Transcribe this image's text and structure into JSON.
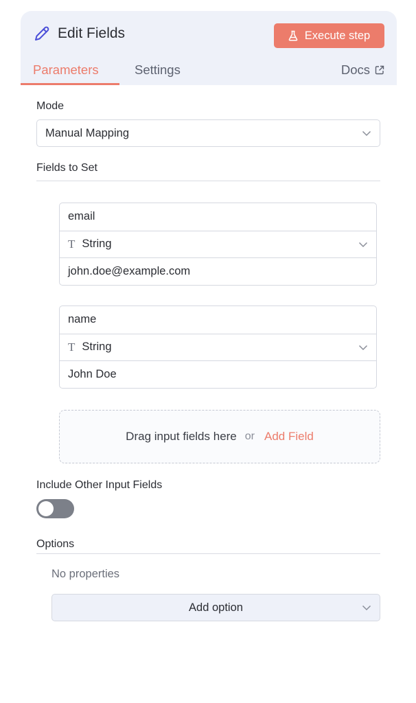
{
  "header": {
    "title": "Edit Fields",
    "execute_label": "Execute step",
    "tabs": [
      {
        "label": "Parameters",
        "active": true
      },
      {
        "label": "Settings",
        "active": false
      }
    ],
    "docs_label": "Docs"
  },
  "mode": {
    "label": "Mode",
    "value": "Manual Mapping"
  },
  "fields_section": {
    "label": "Fields to Set",
    "fields": [
      {
        "name": "email",
        "type": "String",
        "value": "john.doe@example.com"
      },
      {
        "name": "name",
        "type": "String",
        "value": "John Doe"
      }
    ],
    "dropzone": {
      "text": "Drag input fields here",
      "or": "or",
      "add_label": "Add Field"
    }
  },
  "include_other": {
    "label": "Include Other Input Fields",
    "enabled": false
  },
  "options": {
    "label": "Options",
    "empty_text": "No properties",
    "add_label": "Add option"
  },
  "icons": {
    "title_icon": "pencil-icon",
    "execute_icon": "flask-icon",
    "docs_icon": "external-link-icon",
    "type_icon": "text-type-icon",
    "dropdown_icon": "chevron-down-icon"
  },
  "colors": {
    "accent": "#ec7c6b",
    "header_bg": "#eef1f9",
    "pencil": "#4b4fd8",
    "toggle_off": "#7c8089"
  }
}
